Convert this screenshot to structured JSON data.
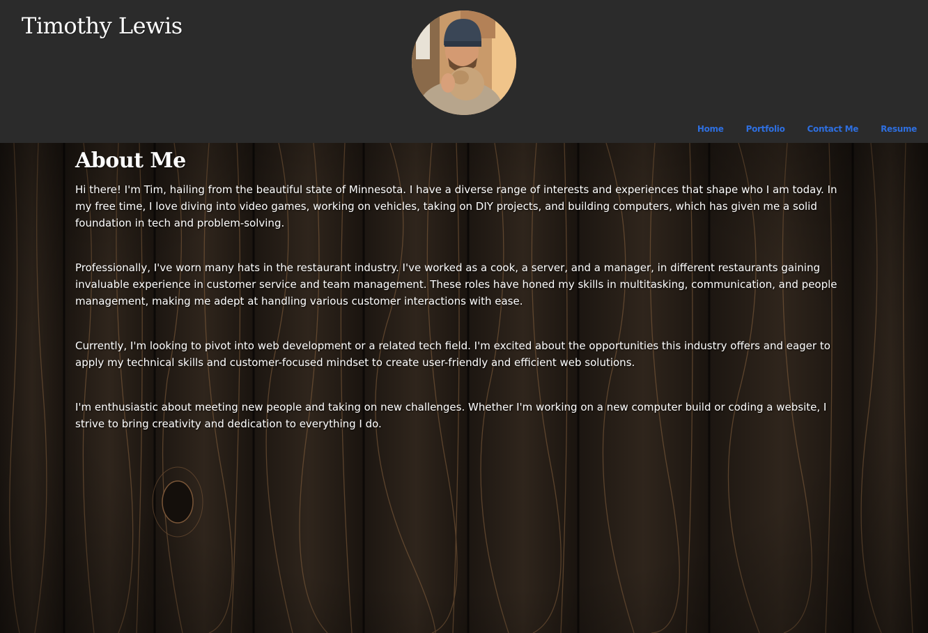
{
  "header": {
    "title": "Timothy Lewis",
    "avatar_alt": "profile-photo"
  },
  "nav": {
    "items": [
      {
        "label": "Home"
      },
      {
        "label": "Portfolio"
      },
      {
        "label": "Contact Me"
      },
      {
        "label": "Resume"
      }
    ]
  },
  "about": {
    "heading": "About Me",
    "paragraphs": [
      "Hi there! I'm Tim, hailing from the beautiful state of Minnesota. I have a diverse range of interests and experiences that shape who I am today. In my free time, I love diving into video games, working on vehicles, taking on DIY projects, and building computers, which has given me a solid foundation in tech and problem-solving.",
      "Professionally, I've worn many hats in the restaurant industry. I've worked as a cook, a server, and a manager, in different restaurants gaining invaluable experience in customer service and team management. These roles have honed my skills in multitasking, communication, and people management, making me adept at handling various customer interactions with ease.",
      "Currently, I'm looking to pivot into web development or a related tech field. I'm excited about the opportunities this industry offers and eager to apply my technical skills and customer-focused mindset to create user-friendly and efficient web solutions.",
      "I'm enthusiastic about meeting new people and taking on new challenges. Whether I'm working on a new computer build or coding a website, I strive to bring creativity and dedication to everything I do."
    ]
  },
  "colors": {
    "header_bg": "#2b2b2b",
    "nav_link": "#2e6fe0",
    "text": "#ffffff"
  }
}
